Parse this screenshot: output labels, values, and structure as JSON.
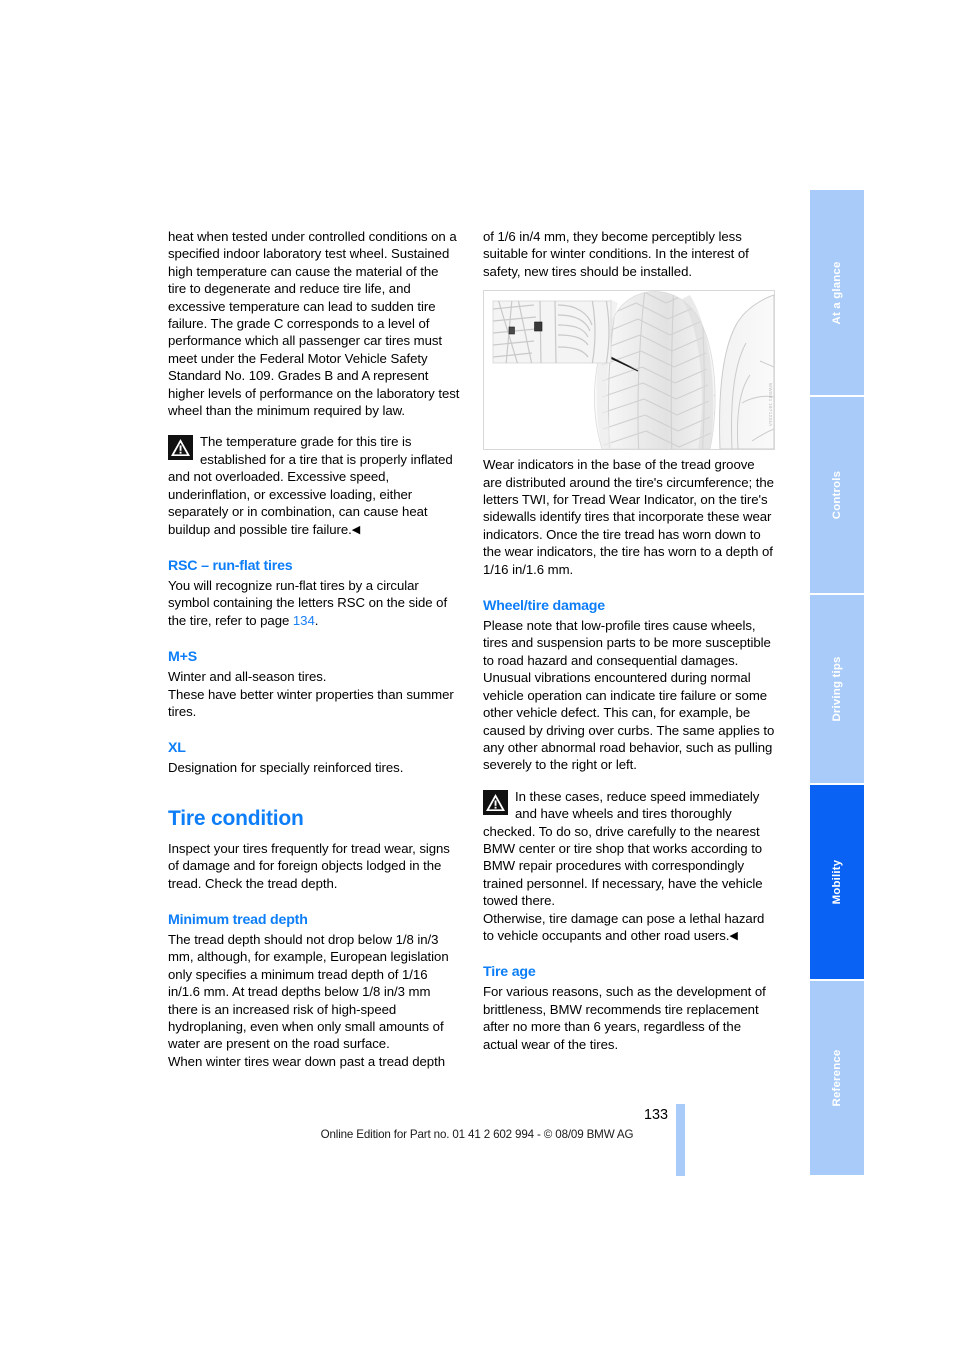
{
  "document": {
    "page_number": "133",
    "footer": "Online Edition for Part no. 01 41 2 602 994 - © 08/09 BMW AG"
  },
  "sidebar": {
    "tabs": [
      {
        "label": "At a glance",
        "active": false
      },
      {
        "label": "Controls",
        "active": false
      },
      {
        "label": "Driving tips",
        "active": false
      },
      {
        "label": "Mobility",
        "active": true
      },
      {
        "label": "Reference",
        "active": false
      }
    ],
    "active_color": "#0a62f5",
    "inactive_color": "#a8cbfa"
  },
  "left_column": {
    "continued_paragraph": "heat when tested under controlled conditions on a specified indoor laboratory test wheel. Sustained high temperature can cause the material of the tire to degenerate and reduce tire life, and excessive temperature can lead to sudden tire failure. The grade C corresponds to a level of performance which all passenger car tires must meet under the Federal Motor Vehicle Safety Standard No. 109. Grades B and A represent higher levels of performance on the laboratory test wheel than the minimum required by law.",
    "warning": {
      "icon": "warning-triangle-icon",
      "text": "The temperature grade for this tire is established for a tire that is properly inflated and not overloaded. Excessive speed, underinflation, or excessive loading, either separately or in combination, can cause heat buildup and possible tire failure.",
      "end_marker": "◀"
    },
    "rsc": {
      "heading": "RSC – run-flat tires",
      "text_before_link": "You will recognize run-flat tires by a circular symbol containing the letters RSC on the side of the tire, refer to page ",
      "link": "134",
      "text_after_link": "."
    },
    "ms": {
      "heading": "M+S",
      "line1": "Winter and all-season tires.",
      "line2": "These have better winter properties than summer tires."
    },
    "xl": {
      "heading": "XL",
      "text": "Designation for specially reinforced tires."
    },
    "tire_condition": {
      "heading": "Tire condition",
      "intro": "Inspect your tires frequently for tread wear, signs of damage and for foreign objects lodged in the tread. Check the tread depth.",
      "minimum_tread_depth": {
        "heading": "Minimum tread depth",
        "text": "The tread depth should not drop below 1/8 in/3 mm, although, for example, European legislation only specifies a minimum tread depth of 1/16 in/1.6 mm. At tread depths below 1/8 in/3 mm there is an increased risk of high-speed hydroplaning, even when only small amounts of water are present on the road surface.",
        "text2": "When winter tires wear down past a tread depth"
      }
    }
  },
  "right_column": {
    "continued_paragraph": "of 1/6 in/4 mm, they become perceptibly less suitable for winter conditions. In the interest of safety, new tires should be installed.",
    "figure": {
      "name": "tire-tread-wear-indicator-illustration",
      "caption_id": "WWEB1 1871234A"
    },
    "wear_indicators": "Wear indicators in the base of the tread groove are distributed around the tire's circumference; the letters TWI, for Tread Wear Indicator, on the tire's sidewalls identify tires that incorporate these wear indicators. Once the tire tread has worn down to the wear indicators, the tire has worn to a depth of 1/16 in/1.6 mm.",
    "wheel_tire_damage": {
      "heading": "Wheel/tire damage",
      "para1": "Please note that low-profile tires cause wheels, tires and suspension parts to be more susceptible to road hazard and consequential damages.",
      "para2": "Unusual vibrations encountered during normal vehicle operation can indicate tire failure or some other vehicle defect. This can, for example, be caused by driving over curbs. The same applies to any other abnormal road behavior, such as pulling severely to the right or left.",
      "warning": {
        "icon": "warning-triangle-icon",
        "text": "In these cases, reduce speed immediately and have wheels and tires thoroughly checked. To do so, drive carefully to the nearest BMW center or tire shop that works according to BMW repair procedures with correspondingly trained personnel. If necessary, have the vehicle towed there.",
        "text2": "Otherwise, tire damage can pose a lethal hazard to vehicle occupants and other road users.",
        "end_marker": "◀"
      }
    },
    "tire_age": {
      "heading": "Tire age",
      "text": "For various reasons, such as the development of brittleness, BMW recommends tire replacement after no more than 6 years, regardless of the actual wear of the tires."
    }
  }
}
